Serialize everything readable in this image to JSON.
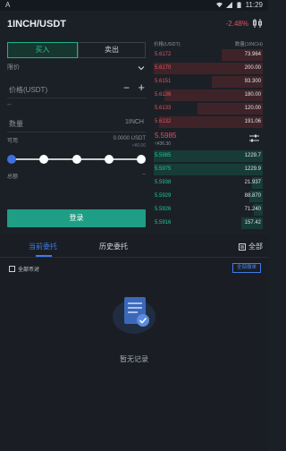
{
  "status_bar": {
    "left_glyph": "A",
    "time": "11:29",
    "icons": [
      "wifi-icon",
      "signal-icon",
      "battery-icon"
    ]
  },
  "header": {
    "pair": "1INCH/USDT",
    "change": "-2.48%",
    "chart_icon": "candlestick-icon"
  },
  "trade": {
    "buy_tab": "买入",
    "sell_tab": "卖出",
    "order_type": "限价",
    "price_placeholder": "价格(USDT)",
    "price_minus": "−",
    "price_plus": "+",
    "approx": "--",
    "qty_placeholder": "数量",
    "qty_unit": "1INCH",
    "available_label": "可用",
    "available_value": "0.0000 USDT",
    "available_sub": "≈¥0.00",
    "slider_position": 0,
    "total_label": "总额",
    "total_value": "--",
    "login_button": "登录"
  },
  "orderbook": {
    "price_header": "价格(USDT)",
    "qty_header": "数量(1INCH)",
    "asks": [
      {
        "price": "5.6172",
        "qty": "73.964",
        "depth": 0.38
      },
      {
        "price": "5.6170",
        "qty": "200.00",
        "depth": 1.0
      },
      {
        "price": "5.6151",
        "qty": "93.300",
        "depth": 0.47
      },
      {
        "price": "5.6136",
        "qty": "180.00",
        "depth": 0.9
      },
      {
        "price": "5.6133",
        "qty": "120.00",
        "depth": 0.6
      },
      {
        "price": "5.6132",
        "qty": "191.06",
        "depth": 0.95
      }
    ],
    "mid_price": "5.5985",
    "mid_fiat": "≈¥36.30",
    "bids": [
      {
        "price": "5.5985",
        "qty": "1229.7",
        "depth": 1.0
      },
      {
        "price": "5.5975",
        "qty": "1229.9",
        "depth": 1.0
      },
      {
        "price": "5.5938",
        "qty": "21.937",
        "depth": 0.1
      },
      {
        "price": "5.5929",
        "qty": "88.870",
        "depth": 0.12
      },
      {
        "price": "5.5926",
        "qty": "71.240",
        "depth": 0.08
      },
      {
        "price": "5.5916",
        "qty": "157.42",
        "depth": 0.2
      }
    ]
  },
  "orders": {
    "tab_current": "当前委托",
    "tab_history": "历史委托",
    "all_label": "全部",
    "all_pairs_label": "全部币对",
    "cancel_all": "全部撤单",
    "empty_text": "暂无记录"
  },
  "colors": {
    "buy": "#23c49a",
    "sell": "#e2515f",
    "accent": "#3f7be8",
    "background": "#1b2026"
  }
}
